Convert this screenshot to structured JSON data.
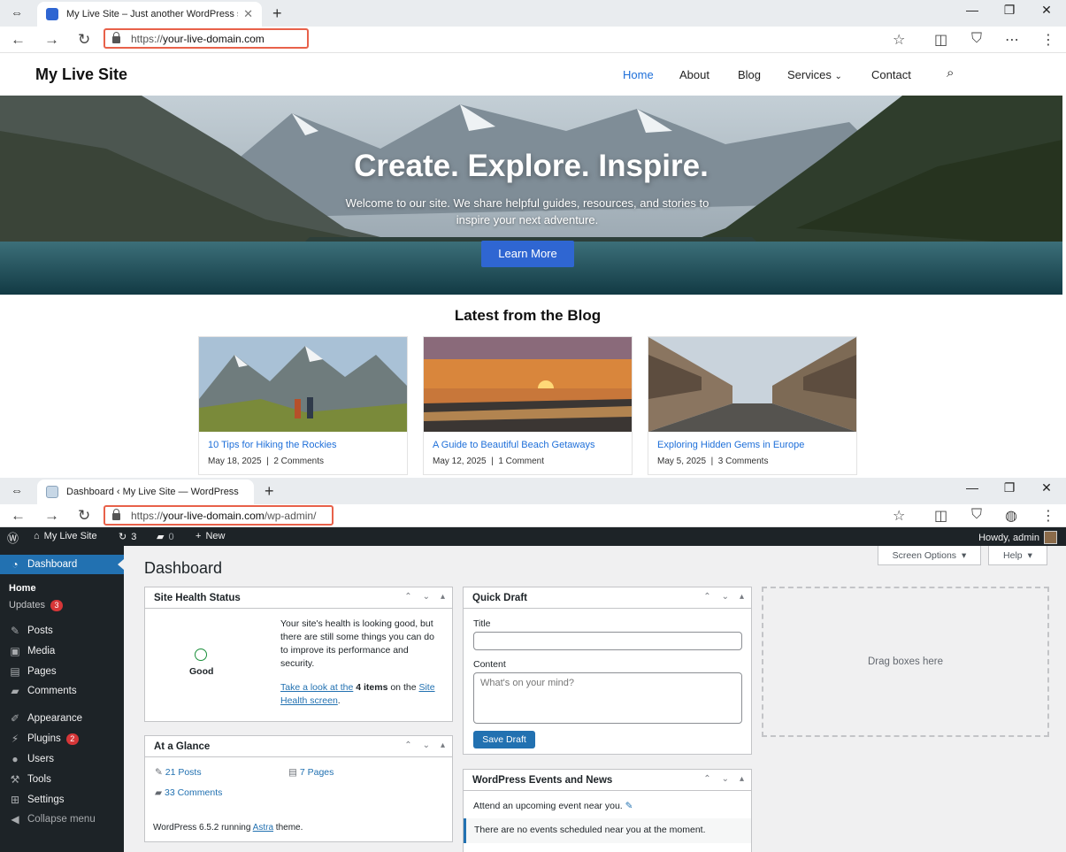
{
  "top_window": {
    "tab_title": "My Live Site – Just another WordPress site",
    "url_prefix": "https://",
    "url_host": "your-live-domain.com",
    "url_path": "",
    "site": {
      "logo": "My Live Site",
      "menu": [
        "Home",
        "About",
        "Blog",
        "Services",
        "Contact"
      ],
      "active_menu": "Home"
    },
    "hero": {
      "title": "Create. Explore. Inspire.",
      "subtitle": "Welcome to our site. We share helpful guides, resources, and stories to inspire your next adventure.",
      "button": "Learn More"
    },
    "blog": {
      "heading": "Latest from the Blog",
      "posts": [
        {
          "title": "10 Tips for Hiking the Rockies",
          "date": "May 18, 2025",
          "comments": "2 Comments"
        },
        {
          "title": "A Guide to Beautiful Beach Getaways",
          "date": "May 12, 2025",
          "comments": "1 Comment"
        },
        {
          "title": "Exploring Hidden Gems in Europe",
          "date": "May 5, 2025",
          "comments": "3 Comments"
        }
      ]
    }
  },
  "bottom_window": {
    "tab_title": "Dashboard ‹ My Live Site — WordPress",
    "url_prefix": "https://",
    "url_host": "your-live-domain.com",
    "url_path": "/wp-admin/",
    "admin_bar": {
      "site_name": "My Live Site",
      "updates": "3",
      "comments": "0",
      "new": "New",
      "howdy": "Howdy, admin"
    },
    "sidebar": {
      "dashboard": "Dashboard",
      "home": "Home",
      "updates": "Updates",
      "updates_count": "3",
      "items": [
        "Posts",
        "Media",
        "Pages",
        "Comments",
        "Appearance",
        "Plugins",
        "Users",
        "Tools",
        "Settings"
      ],
      "plugins_count": "2",
      "collapse": "Collapse menu"
    },
    "dashboard": {
      "title": "Dashboard",
      "screen_options": "Screen Options",
      "help": "Help"
    },
    "site_health": {
      "title": "Site Health Status",
      "status": "Good",
      "text": "Your site's health is looking good, but there are still some things you can do to improve its performance and security.",
      "link1": "Take a look at the",
      "count": "4 items",
      "mid": "on the",
      "link2": "Site Health screen",
      "end": "."
    },
    "at_a_glance": {
      "title": "At a Glance",
      "posts": "21 Posts",
      "pages": "7 Pages",
      "comments": "33 Comments",
      "version_pre": "WordPress 6.5.2 running",
      "theme": "Astra",
      "version_post": "theme."
    },
    "quick_draft": {
      "title": "Quick Draft",
      "title_label": "Title",
      "content_label": "Content",
      "content_placeholder": "What's on your mind?",
      "save": "Save Draft"
    },
    "events": {
      "title": "WordPress Events and News",
      "attend": "Attend an upcoming event near you.",
      "none": "There are no events scheduled near you at the moment."
    },
    "dropzone": "Drag boxes here"
  },
  "colors": {
    "accent": "#1e6fd9",
    "wp_blue": "#2271b1",
    "admin_dark": "#1d2327",
    "badge_red": "#d63638",
    "url_highlight": "#e8614a"
  }
}
